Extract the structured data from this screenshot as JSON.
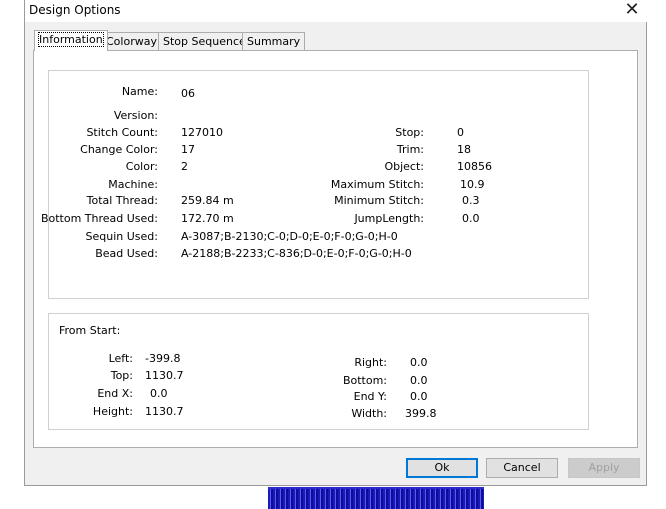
{
  "window": {
    "title": "Design Options",
    "close_glyph": "✕"
  },
  "tabs": [
    {
      "label": "Information",
      "active": true
    },
    {
      "label": "Colorway",
      "active": false
    },
    {
      "label": "Stop Sequence",
      "active": false
    },
    {
      "label": "Summary",
      "active": false
    }
  ],
  "info": {
    "name_label": "Name:",
    "name_value": "06",
    "version_label": "Version:",
    "version_value": "",
    "stitch_count_label": "Stitch Count:",
    "stitch_count_value": "127010",
    "change_color_label": "Change Color:",
    "change_color_value": "17",
    "color_label": "Color:",
    "color_value": "2",
    "machine_label": "Machine:",
    "machine_value": "",
    "total_thread_label": "Total Thread:",
    "total_thread_value": "259.84 m",
    "bottom_thread_label": "Bottom Thread Used:",
    "bottom_thread_value": "172.70 m",
    "sequin_label": "Sequin Used:",
    "sequin_value": "A-3087;B-2130;C-0;D-0;E-0;F-0;G-0;H-0",
    "bead_label": "Bead Used:",
    "bead_value": "A-2188;B-2233;C-836;D-0;E-0;F-0;G-0;H-0",
    "stop_label": "Stop:",
    "stop_value": "0",
    "trim_label": "Trim:",
    "trim_value": "18",
    "object_label": "Object:",
    "object_value": "10856",
    "max_stitch_label": "Maximum Stitch:",
    "max_stitch_value": "10.9",
    "min_stitch_label": "Minimum Stitch:",
    "min_stitch_value": "0.3",
    "jump_length_label": "JumpLength:",
    "jump_length_value": "0.0"
  },
  "from_start": {
    "heading": "From Start:",
    "left_label": "Left:",
    "left_value": "-399.8",
    "top_label": "Top:",
    "top_value": "1130.7",
    "endx_label": "End X:",
    "endx_value": "0.0",
    "height_label": "Height:",
    "height_value": "1130.7",
    "right_label": "Right:",
    "right_value": "0.0",
    "bottom_label": "Bottom:",
    "bottom_value": "0.0",
    "endy_label": "End Y:",
    "endy_value": "0.0",
    "width_label": "Width:",
    "width_value": "399.8"
  },
  "buttons": {
    "ok": "Ok",
    "cancel": "Cancel",
    "apply": "Apply"
  },
  "colors": {
    "dialog_bg": "#f0f0f0",
    "ok_border": "#0078d7",
    "embroidery": "#1a1ab8"
  }
}
